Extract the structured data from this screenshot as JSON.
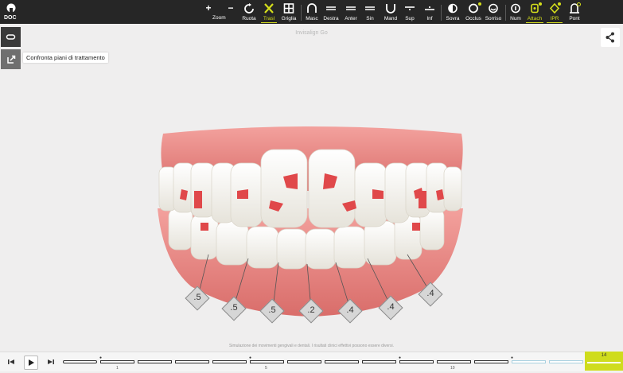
{
  "toolbar": {
    "doc_label": "DOC",
    "zoom_label": "Zoom",
    "items": [
      {
        "label": "Ruota",
        "icon": "rotate-icon"
      },
      {
        "label": "Trasl",
        "icon": "translate-icon",
        "active": true
      },
      {
        "label": "Griglia",
        "icon": "grid-icon"
      },
      {
        "label": "Masc",
        "icon": "jaw-icon"
      },
      {
        "label": "Destra",
        "icon": "right-view-icon"
      },
      {
        "label": "Anter",
        "icon": "front-view-icon"
      },
      {
        "label": "Sin",
        "icon": "left-view-icon"
      },
      {
        "label": "Mand",
        "icon": "mandible-icon"
      },
      {
        "label": "Sup",
        "icon": "upper-icon"
      },
      {
        "label": "Inf",
        "icon": "lower-icon"
      },
      {
        "label": "Sovra",
        "icon": "overlay-icon"
      },
      {
        "label": "Occlus",
        "icon": "occlusion-icon"
      },
      {
        "label": "Sorriso",
        "icon": "smile-icon"
      },
      {
        "label": "Num",
        "icon": "number-icon"
      },
      {
        "label": "Attach",
        "icon": "attachment-icon",
        "active": true
      },
      {
        "label": "IPR",
        "icon": "ipr-icon",
        "active": true
      },
      {
        "label": "Pont",
        "icon": "pontic-icon"
      }
    ]
  },
  "tooltip": "Confronta piani di trattamento",
  "app_title": "Invisalign Go",
  "ipr_values": [
    ".5",
    ".5",
    ".5",
    ".2",
    ".4",
    ".4",
    ".4"
  ],
  "disclaimer": "Simulazione dei movimenti gengivali e dentali. I risultati clinici effettivi possono essere diversi.",
  "timeline": {
    "tick_labels": [
      "1",
      "5",
      "10"
    ],
    "current_stage": "14"
  },
  "colors": {
    "accent": "#d4de1c",
    "toolbar": "#262626",
    "gum": "#e07a77",
    "attachment": "#e0484a"
  }
}
